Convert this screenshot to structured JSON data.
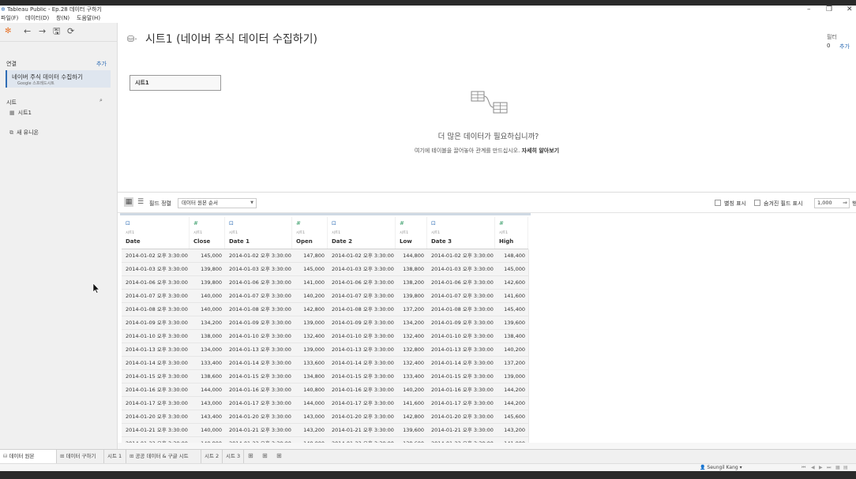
{
  "window": {
    "title": "Tableau Public - Ep.28 데이터 구하기"
  },
  "menu": [
    "파일(F)",
    "데이터(D)",
    "창(N)",
    "도움말(H)"
  ],
  "sidebar": {
    "connections_label": "연결",
    "add_label": "추가",
    "connection": {
      "name": "네이버 주식 데이터 수집하기",
      "sub": "Google 스프레드시트"
    },
    "sheets_label": "시트",
    "sheet": "시트1",
    "new_union": "새 유니온"
  },
  "canvas": {
    "title": "시트1 (네이버 주식 데이터 수집하기)",
    "filters_label": "필터",
    "filters_count": "0",
    "filters_add": "추가",
    "table_chip": "시트1",
    "empty_title": "더 많은 데이터가 필요하십니까?",
    "empty_desc": "여기에 테이블을 끌어놓아 관계를 만드십시오.",
    "learn_more": "자세히 알아보기"
  },
  "grid_toolbar": {
    "sort_label": "필드 정렬",
    "sort_value": "데이터 원본 순서",
    "show_alias": "별칭 표시",
    "show_hidden": "숨겨진 필드 표시",
    "rows_value": "1,000",
    "rows_suffix": "행"
  },
  "grid": {
    "source": "시트1",
    "columns": [
      {
        "name": "Date",
        "type": "date"
      },
      {
        "name": "Close",
        "type": "num"
      },
      {
        "name": "Date 1",
        "type": "date"
      },
      {
        "name": "Open",
        "type": "num"
      },
      {
        "name": "Date 2",
        "type": "date"
      },
      {
        "name": "Low",
        "type": "num"
      },
      {
        "name": "Date 3",
        "type": "date"
      },
      {
        "name": "High",
        "type": "num"
      }
    ],
    "rows": [
      [
        "2014-01-02 오후 3:30:00",
        "145,000",
        "2014-01-02 오후 3:30:00",
        "147,800",
        "2014-01-02 오후 3:30:00",
        "144,800",
        "2014-01-02 오후 3:30:00",
        "148,400"
      ],
      [
        "2014-01-03 오후 3:30:00",
        "139,800",
        "2014-01-03 오후 3:30:00",
        "145,000",
        "2014-01-03 오후 3:30:00",
        "138,800",
        "2014-01-03 오후 3:30:00",
        "145,000"
      ],
      [
        "2014-01-06 오후 3:30:00",
        "139,800",
        "2014-01-06 오후 3:30:00",
        "141,000",
        "2014-01-06 오후 3:30:00",
        "138,200",
        "2014-01-06 오후 3:30:00",
        "142,600"
      ],
      [
        "2014-01-07 오후 3:30:00",
        "140,000",
        "2014-01-07 오후 3:30:00",
        "140,200",
        "2014-01-07 오후 3:30:00",
        "139,800",
        "2014-01-07 오후 3:30:00",
        "141,600"
      ],
      [
        "2014-01-08 오후 3:30:00",
        "140,000",
        "2014-01-08 오후 3:30:00",
        "142,800",
        "2014-01-08 오후 3:30:00",
        "137,200",
        "2014-01-08 오후 3:30:00",
        "145,400"
      ],
      [
        "2014-01-09 오후 3:30:00",
        "134,200",
        "2014-01-09 오후 3:30:00",
        "139,000",
        "2014-01-09 오후 3:30:00",
        "134,200",
        "2014-01-09 오후 3:30:00",
        "139,600"
      ],
      [
        "2014-01-10 오후 3:30:00",
        "138,000",
        "2014-01-10 오후 3:30:00",
        "132,400",
        "2014-01-10 오후 3:30:00",
        "132,400",
        "2014-01-10 오후 3:30:00",
        "138,400"
      ],
      [
        "2014-01-13 오후 3:30:00",
        "134,000",
        "2014-01-13 오후 3:30:00",
        "139,000",
        "2014-01-13 오후 3:30:00",
        "132,800",
        "2014-01-13 오후 3:30:00",
        "140,200"
      ],
      [
        "2014-01-14 오후 3:30:00",
        "133,400",
        "2014-01-14 오후 3:30:00",
        "133,600",
        "2014-01-14 오후 3:30:00",
        "132,400",
        "2014-01-14 오후 3:30:00",
        "137,200"
      ],
      [
        "2014-01-15 오후 3:30:00",
        "138,600",
        "2014-01-15 오후 3:30:00",
        "134,800",
        "2014-01-15 오후 3:30:00",
        "133,400",
        "2014-01-15 오후 3:30:00",
        "139,000"
      ],
      [
        "2014-01-16 오후 3:30:00",
        "144,000",
        "2014-01-16 오후 3:30:00",
        "140,800",
        "2014-01-16 오후 3:30:00",
        "140,200",
        "2014-01-16 오후 3:30:00",
        "144,200"
      ],
      [
        "2014-01-17 오후 3:30:00",
        "143,000",
        "2014-01-17 오후 3:30:00",
        "144,000",
        "2014-01-17 오후 3:30:00",
        "141,600",
        "2014-01-17 오후 3:30:00",
        "144,200"
      ],
      [
        "2014-01-20 오후 3:30:00",
        "143,400",
        "2014-01-20 오후 3:30:00",
        "143,000",
        "2014-01-20 오후 3:30:00",
        "142,800",
        "2014-01-20 오후 3:30:00",
        "145,600"
      ],
      [
        "2014-01-21 오후 3:30:00",
        "140,000",
        "2014-01-21 오후 3:30:00",
        "143,200",
        "2014-01-21 오후 3:30:00",
        "139,600",
        "2014-01-21 오후 3:30:00",
        "143,200"
      ],
      [
        "2014-01-22 오후 3:30:00",
        "140,800",
        "2014-01-22 오후 3:30:00",
        "140,000",
        "2014-01-22 오후 3:30:00",
        "138,600",
        "2014-01-22 오후 3:30:00",
        "141,000"
      ]
    ]
  },
  "tabs": {
    "data_source": "데이터 원본",
    "items": [
      "데이터 구하기",
      "시트 1",
      "공공 데이터 & 구글 시트",
      "시트 2",
      "시트 3"
    ]
  },
  "status": {
    "user": "Seungil Kang"
  },
  "colors": {
    "accent": "#2f6db5",
    "date_icon": "#2f6db5",
    "number_icon": "#3fa06e",
    "logo": "#e8762d"
  }
}
